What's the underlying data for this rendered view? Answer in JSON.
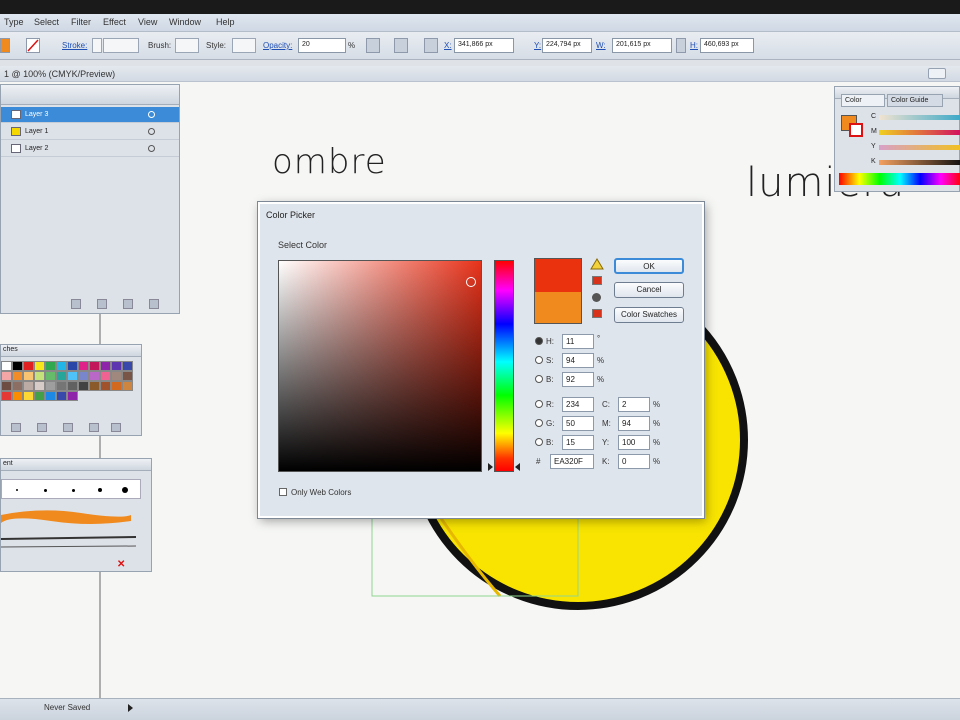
{
  "menu": {
    "items": [
      "Type",
      "Select",
      "Filter",
      "Effect",
      "View",
      "Window",
      "Help"
    ]
  },
  "control_bar": {
    "stroke_label": "Stroke:",
    "brush_label": "Brush:",
    "style_label": "Style:",
    "opacity_label": "Opacity:",
    "opacity_value": "20",
    "opacity_unit": "%",
    "x_label": "X:",
    "x_value": "341,866 px",
    "y_label": "Y:",
    "y_value": "224,794 px",
    "w_label": "W:",
    "w_value": "201,615 px",
    "h_label": "H:",
    "h_value": "460,693 px"
  },
  "document": {
    "title": "1 @ 100% (CMYK/Preview)"
  },
  "layers_panel": {
    "layers": [
      {
        "name": "Layer 3",
        "color": "#ffffff",
        "selected": true
      },
      {
        "name": "Layer 1",
        "color": "#f5d800",
        "selected": false
      },
      {
        "name": "Layer 2",
        "color": "#ffffff",
        "selected": false
      }
    ]
  },
  "swatches_panel": {
    "tab_label": "ches"
  },
  "brushes_panel": {
    "tab_label": "ent"
  },
  "color_panel": {
    "tabs": [
      "Color",
      "Color Guide"
    ],
    "channels": [
      "C",
      "M",
      "Y",
      "K"
    ],
    "fill_color": "#f08a1e"
  },
  "handwriting": {
    "left": "ombre",
    "right": "lumiera"
  },
  "color_picker": {
    "title": "Color Picker",
    "select_label": "Select Color",
    "new_color": "#ea320f",
    "old_color": "#f08a1e",
    "ok_label": "OK",
    "cancel_label": "Cancel",
    "swatches_label": "Color Swatches",
    "h_label": "H:",
    "h_value": "11",
    "h_unit": "°",
    "s_label": "S:",
    "s_value": "94",
    "s_unit": "%",
    "b_label": "B:",
    "b_value": "92",
    "b_unit": "%",
    "r_label": "R:",
    "r_value": "234",
    "g_label": "G:",
    "g_value": "50",
    "bl_label": "B:",
    "bl_value": "15",
    "hex_label": "#",
    "hex_value": "EA320F",
    "c_label": "C:",
    "c_value": "2",
    "m_label": "M:",
    "m_value": "94",
    "y_label": "Y:",
    "y_value": "100",
    "k_label": "K:",
    "k_value": "0",
    "pct": "%",
    "web_label": "Only Web Colors"
  },
  "status": {
    "save_state": "Never Saved"
  },
  "colors": {
    "accent": "#3b8bd9",
    "circle_fill": "#f8e400",
    "circle_stroke": "#111111"
  }
}
